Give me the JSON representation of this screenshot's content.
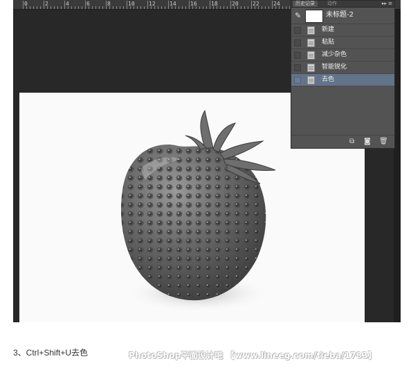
{
  "ruler": {
    "numbers": [
      "0",
      "2",
      "4",
      "6",
      "8",
      "10",
      "12",
      "14",
      "16",
      "18",
      "20",
      "22",
      "24"
    ]
  },
  "history_panel": {
    "tabs": [
      "历史记录",
      "动作"
    ],
    "menu_icon": "panel-menu-icon",
    "snapshot": {
      "label": "未标题-2",
      "icon": "history-brush-icon"
    },
    "items": [
      {
        "label": "新建",
        "selected": false
      },
      {
        "label": "粘贴",
        "selected": false
      },
      {
        "label": "减少杂色",
        "selected": false
      },
      {
        "label": "智能锐化",
        "selected": false
      },
      {
        "label": "去色",
        "selected": true
      }
    ],
    "footer_icons": [
      "new-document-from-state-icon",
      "camera-snapshot-icon",
      "trash-icon"
    ]
  },
  "colors": {
    "workspace": "#282828",
    "panel": "#535353",
    "selection": "#62738a",
    "canvas": "#fafafa"
  },
  "caption": "3、Ctrl+Shift+U去色",
  "watermark": "PhotoShop平面设计吧 【www.lineeg.com/tieba/1783】"
}
